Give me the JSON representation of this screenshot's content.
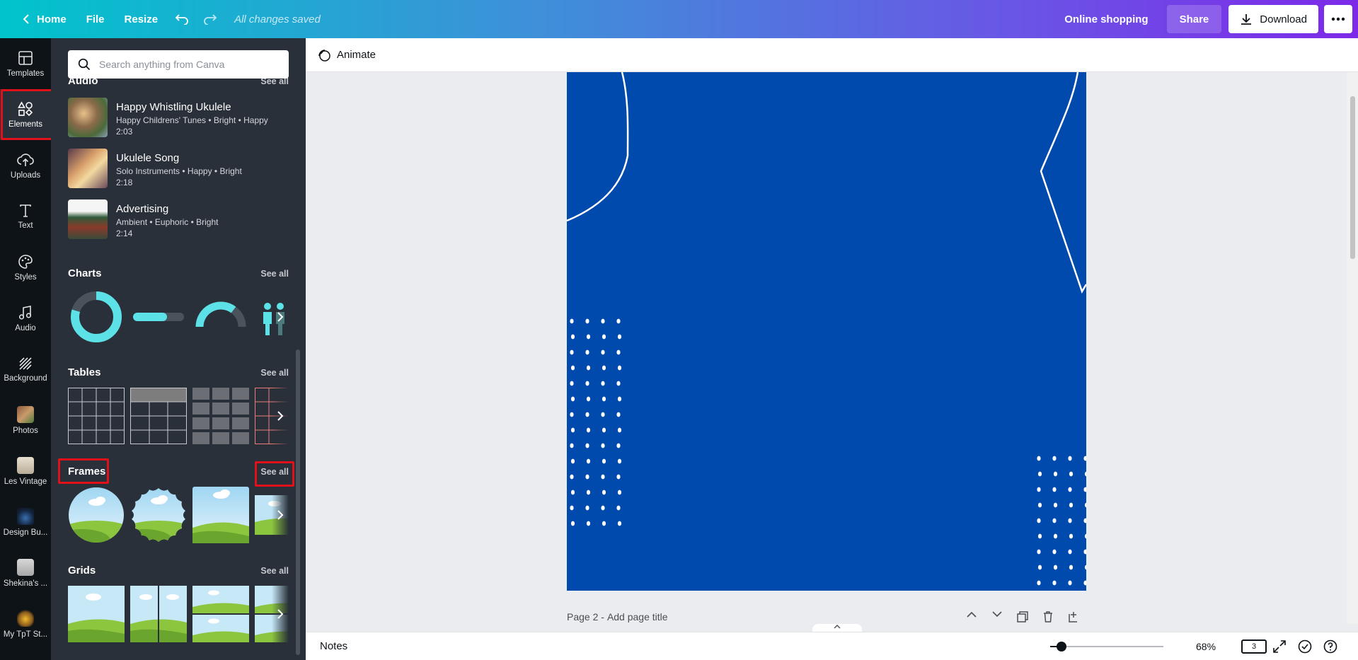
{
  "topbar": {
    "home": "Home",
    "file": "File",
    "resize": "Resize",
    "status": "All changes saved",
    "title": "Online shopping",
    "share": "Share",
    "download": "Download"
  },
  "rail": {
    "items": [
      {
        "label": "Templates",
        "icon": "templates-icon"
      },
      {
        "label": "Elements",
        "icon": "elements-icon"
      },
      {
        "label": "Uploads",
        "icon": "upload-icon"
      },
      {
        "label": "Text",
        "icon": "text-icon"
      },
      {
        "label": "Styles",
        "icon": "palette-icon"
      },
      {
        "label": "Audio",
        "icon": "music-note-icon"
      },
      {
        "label": "Background",
        "icon": "background-icon"
      },
      {
        "label": "Photos",
        "icon": "photos-icon"
      },
      {
        "label": "Les Vintage",
        "icon": "folder-thumb"
      },
      {
        "label": "Design Bu...",
        "icon": "folder-thumb"
      },
      {
        "label": "Shekina's ...",
        "icon": "folder-thumb"
      },
      {
        "label": "My TpT St...",
        "icon": "folder-thumb"
      }
    ]
  },
  "panel": {
    "search_placeholder": "Search anything from Canva",
    "audio": {
      "title": "Audio",
      "see_all": "See all",
      "tracks": [
        {
          "title": "Happy Whistling Ukulele",
          "meta": "Happy Childrens' Tunes • Bright • Happy",
          "duration": "2:03"
        },
        {
          "title": "Ukulele Song",
          "meta": "Solo Instruments • Happy • Bright",
          "duration": "2:18"
        },
        {
          "title": "Advertising",
          "meta": "Ambient • Euphoric • Bright",
          "duration": "2:14"
        }
      ]
    },
    "charts": {
      "title": "Charts",
      "see_all": "See all"
    },
    "tables": {
      "title": "Tables",
      "see_all": "See all"
    },
    "frames": {
      "title": "Frames",
      "see_all": "See all"
    },
    "grids": {
      "title": "Grids",
      "see_all": "See all"
    }
  },
  "editor": {
    "animate": "Animate",
    "page_label": "Page 2 - ",
    "page_title_placeholder": "Add page title",
    "page_color": "#004aad"
  },
  "bottombar": {
    "notes": "Notes",
    "zoom": "68%",
    "zoom_fraction": 0.1,
    "page_count": "3"
  },
  "colors": {
    "accent_red": "#e0111a",
    "chart_cyan": "#5ce1e6",
    "panel_bg": "#293039"
  }
}
